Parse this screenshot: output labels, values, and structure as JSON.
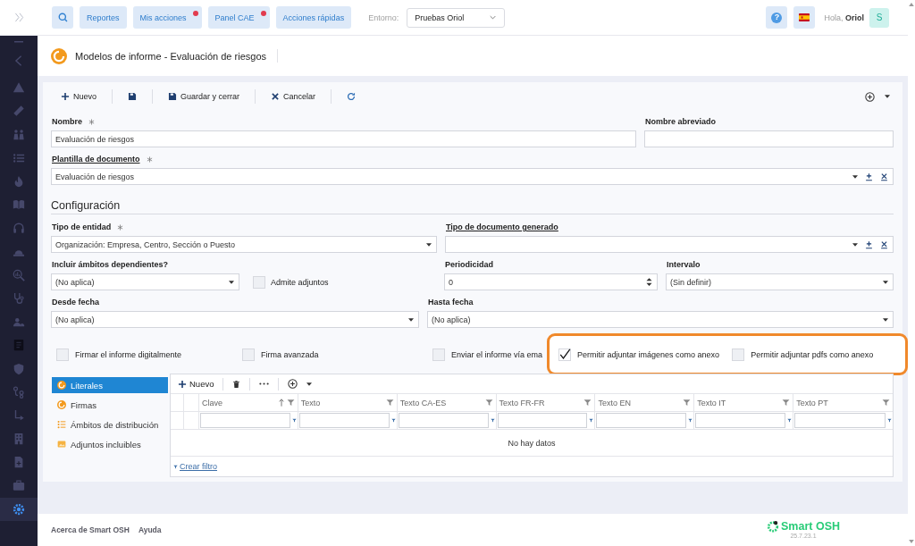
{
  "topbar": {
    "buttons": [
      {
        "label": "Reportes",
        "notification": false
      },
      {
        "label": "Mis acciones",
        "notification": true
      },
      {
        "label": "Panel CAE",
        "notification": true
      },
      {
        "label": "Acciones rápidas",
        "notification": false
      }
    ],
    "environment": {
      "label": "Entorno:",
      "value": "Pruebas Oriol"
    },
    "help": "?",
    "greeting": "Hola, **Oriol**",
    "avatar": "S"
  },
  "sidebar": {
    "items": [
      {
        "selected": false
      },
      {
        "selected": false
      },
      {
        "selected": false
      },
      {
        "selected": false
      },
      {
        "selected": false
      },
      {
        "selected": false
      },
      {
        "selected": false
      },
      {
        "selected": false
      },
      {
        "selected": false
      },
      {
        "selected": false
      },
      {
        "selected": false
      },
      {
        "selected": false
      },
      {
        "selected": false
      },
      {
        "selected": false
      },
      {
        "selected": false
      },
      {
        "selected": false
      },
      {
        "selected": false
      },
      {
        "selected": false
      },
      {
        "selected": false
      },
      {
        "selected": true
      }
    ]
  },
  "page": {
    "title": "Modelos de informe - Evaluación de riesgos"
  },
  "toolbar": {
    "items": [
      {
        "kind": "add",
        "label": "Nuevo"
      },
      {
        "kind": "save"
      },
      {
        "kind": "saveclose",
        "label": "Guardar y cerrar"
      },
      {
        "kind": "cancel",
        "label": "Cancelar"
      },
      {
        "kind": "refresh"
      }
    ]
  },
  "form": {
    "rows": [
      [
        {
          "kind": "text",
          "label": "Nombre",
          "required": true,
          "value": "Evaluación de riesgos"
        },
        {
          "kind": "text",
          "label": "Nombre abreviado",
          "required": false
        }
      ],
      [
        {
          "kind": "lookup",
          "label": "Plantilla de documento",
          "required": true,
          "value": "Evaluación de riesgos"
        }
      ]
    ]
  },
  "configuration": {
    "title": "Configuración",
    "rows": [
      [
        {
          "kind": "select",
          "label": "Tipo de entidad",
          "required": true,
          "value": "Organización: Empresa, Centro, Sección o Puesto"
        },
        {
          "kind": "lookup",
          "label": "Tipo de documento generado",
          "required": false
        }
      ],
      [
        {
          "kind": "select",
          "label": "Incluir ámbitos dependientes?",
          "required": false,
          "value": "(No aplica)"
        },
        {
          "kind": "checkbox",
          "label": "Admite adjuntos",
          "checked": false
        },
        {
          "kind": "number",
          "label": "Periodicidad",
          "required": false,
          "value": "0"
        },
        {
          "kind": "select",
          "label": "Intervalo",
          "required": false,
          "value": "(Sin definir)"
        }
      ],
      [
        {
          "kind": "select",
          "label": "Desde fecha",
          "required": false,
          "value": "(No aplica)"
        },
        {
          "kind": "select",
          "label": "Hasta fecha",
          "required": false,
          "value": "(No aplica)"
        }
      ]
    ],
    "options": [
      {
        "label": "Firmar el informe digitalmente",
        "checked": false,
        "highlighted": false
      },
      {
        "label": "Firma avanzada",
        "checked": false,
        "highlighted": false
      },
      {
        "label": "Enviar el informe vía ema",
        "checked": false,
        "highlighted": false
      },
      {
        "label": "Permitir adjuntar imágenes como anexo",
        "checked": true,
        "highlighted": true
      },
      {
        "label": "Permitir adjuntar pdfs como anexo",
        "checked": false,
        "highlighted": true
      }
    ]
  },
  "detail": {
    "tabs": [
      {
        "label": "Literales",
        "selected": true
      },
      {
        "label": "Firmas",
        "selected": false
      },
      {
        "label": "Ámbitos de distribución",
        "selected": false
      },
      {
        "label": "Adjuntos incluibles",
        "selected": false
      }
    ],
    "grid": {
      "new_label": "Nuevo",
      "columns": [
        {
          "label": "Clave",
          "sorted": true
        },
        {
          "label": "Texto",
          "sorted": false
        },
        {
          "label": "Texto CA-ES",
          "sorted": false
        },
        {
          "label": "Texto FR-FR",
          "sorted": false
        },
        {
          "label": "Texto EN",
          "sorted": false
        },
        {
          "label": "Texto IT",
          "sorted": false
        },
        {
          "label": "Texto PT",
          "sorted": false
        }
      ],
      "empty_text": "No hay datos",
      "filter_link": "Crear filtro"
    }
  },
  "footer": {
    "links": [
      "Acerca de Smart OSH",
      "Ayuda"
    ],
    "brand": "Smart OSH",
    "version": "25.7.23.1"
  }
}
